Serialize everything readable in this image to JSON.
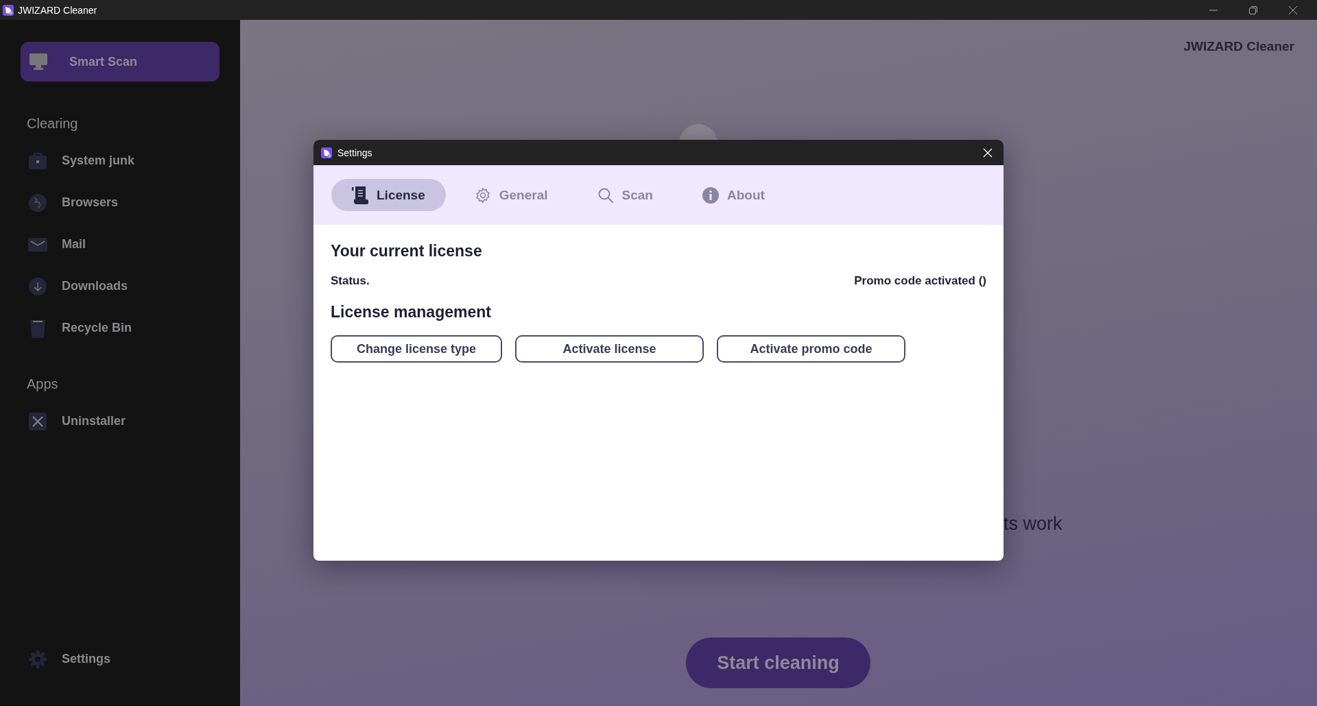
{
  "window": {
    "title": "JWIZARD Cleaner"
  },
  "sidebar": {
    "main_item": {
      "label": "Smart Scan",
      "kind": "monitor",
      "selected": true
    },
    "sections": [
      {
        "title": "Clearing",
        "items": [
          {
            "label": "System junk",
            "kind": "briefcase",
            "selected": false
          },
          {
            "label": "Browsers",
            "kind": "globe",
            "selected": false
          },
          {
            "label": "Mail",
            "kind": "envelope",
            "selected": false
          },
          {
            "label": "Downloads",
            "kind": "download",
            "selected": false
          },
          {
            "label": "Recycle Bin",
            "kind": "bin",
            "selected": false
          }
        ]
      },
      {
        "title": "Apps",
        "items": [
          {
            "label": "Uninstaller",
            "kind": "cross",
            "selected": false
          }
        ]
      }
    ],
    "footer_item": {
      "label": "Settings",
      "kind": "gear",
      "selected": false
    }
  },
  "main": {
    "brand": "JWIZARD Cleaner",
    "message": "ts work",
    "action": "Start cleaning"
  },
  "dialog": {
    "title": "Settings",
    "tabs": [
      {
        "label": "License",
        "kind": "scroll",
        "selected": true
      },
      {
        "label": "General",
        "kind": "gear",
        "selected": false
      },
      {
        "label": "Scan",
        "kind": "search",
        "selected": false
      },
      {
        "label": "About",
        "kind": "info",
        "selected": false
      }
    ],
    "current_heading": "Your current license",
    "status": {
      "label": "Status.",
      "value": "Promo code activated ()"
    },
    "management_heading": "License management",
    "buttons": [
      "Change license type",
      "Activate license",
      "Activate promo code"
    ]
  }
}
